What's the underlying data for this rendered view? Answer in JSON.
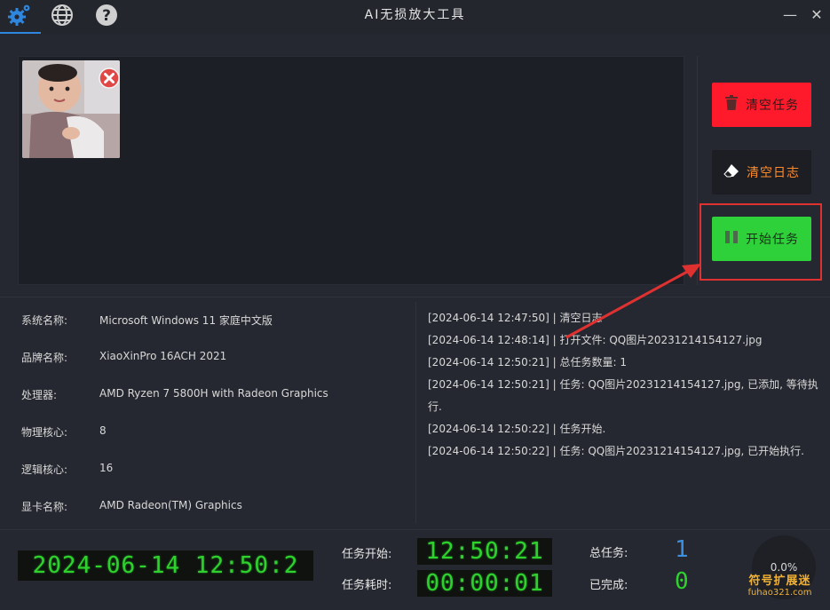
{
  "window": {
    "title": "AI无损放大工具",
    "minimize": "—",
    "close": "✕"
  },
  "toolbar": {
    "tabs": [
      {
        "icon": "settings-icon",
        "active": true
      },
      {
        "icon": "globe-icon",
        "active": false
      },
      {
        "icon": "help-icon",
        "active": false
      }
    ]
  },
  "tasks": {
    "thumbnails": [
      {
        "icon": "baby-photo",
        "remove_icon": "remove-icon"
      }
    ]
  },
  "actions": {
    "clear_tasks": "清空任务",
    "clear_log": "清空日志",
    "start_task": "开始任务"
  },
  "system": {
    "rows": [
      {
        "key": "系统名称:",
        "value": "Microsoft Windows 11 家庭中文版"
      },
      {
        "key": "品牌名称:",
        "value": "XiaoXinPro 16ACH 2021"
      },
      {
        "key": "处理器:",
        "value": "AMD Ryzen 7 5800H with Radeon Graphics"
      },
      {
        "key": "物理核心:",
        "value": "8"
      },
      {
        "key": "逻辑核心:",
        "value": "16"
      },
      {
        "key": "显卡名称:",
        "value": "AMD Radeon(TM) Graphics"
      }
    ]
  },
  "log": {
    "lines": [
      "[2024-06-14 12:47:50] | 清空日志",
      "[2024-06-14 12:48:14] | 打开文件: QQ图片20231214154127.jpg",
      "[2024-06-14 12:50:21] | 总任务数量: 1",
      "[2024-06-14 12:50:21] | 任务: QQ图片20231214154127.jpg, 已添加, 等待执行.",
      "[2024-06-14 12:50:22] | 任务开始.",
      "[2024-06-14 12:50:22] | 任务: QQ图片20231214154127.jpg, 已开始执行."
    ]
  },
  "status": {
    "clock": "2024-06-14 12:50:2",
    "task_start_label": "任务开始:",
    "task_start_value": "12:50:21",
    "task_elapsed_label": "任务耗时:",
    "task_elapsed_value": "00:00:01",
    "total_label": "总任务:",
    "total_value": "1",
    "done_label": "已完成:",
    "done_value": "0",
    "progress": "0.0%"
  },
  "watermark": {
    "line1": "符号扩展迷",
    "line2": "fuhao321.com"
  },
  "colors": {
    "clear_tasks_bg": "#ff1a2b",
    "start_bg": "#2ed13a",
    "clear_log_text": "#ff8c2b",
    "lcd_green": "#2fd12f",
    "total_blue": "#3a8fe0",
    "done_green": "#2fd12f",
    "annotation_red": "#e03131"
  }
}
